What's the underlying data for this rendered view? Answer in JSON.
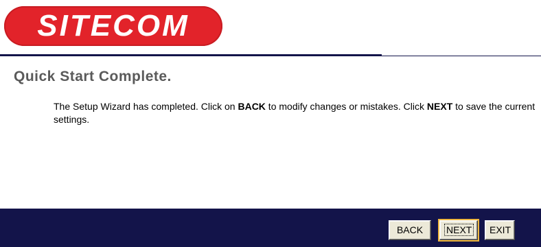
{
  "header": {
    "logo_text": "SITECOM"
  },
  "main": {
    "title": "Quick Start Complete.",
    "message_part1": "The Setup Wizard has completed. Click on ",
    "message_back": "BACK",
    "message_part2": " to modify changes or mistakes. Click ",
    "message_next": "NEXT",
    "message_part3": " to save the current settings."
  },
  "footer": {
    "back_label": "BACK",
    "next_label": "NEXT",
    "exit_label": "EXIT"
  },
  "colors": {
    "brand_red": "#e2232a",
    "navy": "#13144a",
    "title_gray": "#5a5a5a"
  }
}
